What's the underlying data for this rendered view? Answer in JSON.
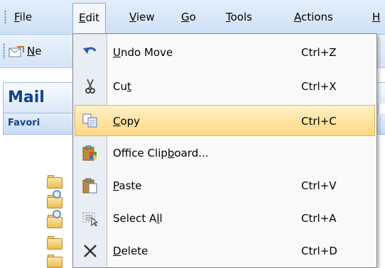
{
  "menubar": {
    "items": [
      {
        "pre": "",
        "u": "F",
        "post": "ile"
      },
      {
        "pre": "",
        "u": "E",
        "post": "dit"
      },
      {
        "pre": "",
        "u": "V",
        "post": "iew"
      },
      {
        "pre": "",
        "u": "G",
        "post": "o"
      },
      {
        "pre": "",
        "u": "T",
        "post": "ools"
      },
      {
        "pre": "",
        "u": "A",
        "post": "ctions"
      },
      {
        "pre": "",
        "u": "H",
        "post": ""
      }
    ]
  },
  "toolbar": {
    "new_pre": "",
    "new_u": "N",
    "new_post": "e"
  },
  "nav": {
    "header": "Mail",
    "favorites": "Favori"
  },
  "edit_menu": {
    "items": [
      {
        "pre": "",
        "u": "U",
        "post": "ndo Move",
        "shortcut": "Ctrl+Z",
        "icon": "undo-icon"
      },
      {
        "pre": "Cu",
        "u": "t",
        "post": "",
        "shortcut": "Ctrl+X",
        "icon": "scissors-icon"
      },
      {
        "pre": "",
        "u": "C",
        "post": "opy",
        "shortcut": "Ctrl+C",
        "icon": "copy-icon",
        "highlighted": true
      },
      {
        "pre": "Office Clip",
        "u": "b",
        "post": "oard...",
        "shortcut": "",
        "icon": "clipboard-icon"
      },
      {
        "pre": "",
        "u": "P",
        "post": "aste",
        "shortcut": "Ctrl+V",
        "icon": "paste-icon"
      },
      {
        "pre": "Select A",
        "u": "l",
        "post": "l",
        "shortcut": "Ctrl+A",
        "icon": "select-all-icon"
      },
      {
        "pre": "",
        "u": "D",
        "post": "elete",
        "shortcut": "Ctrl+D",
        "icon": "delete-icon"
      }
    ]
  },
  "colors": {
    "highlight": "#ffd781",
    "menu_bg": "#fafafa",
    "icon_column": "#e9eef4"
  }
}
